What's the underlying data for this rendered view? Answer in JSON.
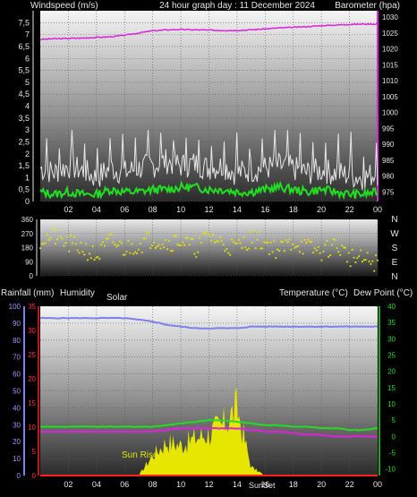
{
  "header": {
    "windspeed_label": "Windspeed (m/s)",
    "title": "24 hour graph day : 11 December 2024",
    "barometer_label": "Barometer (hpa)"
  },
  "direction_labels": [
    "N",
    "W",
    "S",
    "E",
    "N"
  ],
  "bottom_labels": {
    "rainfall": "Rainfall (mm)",
    "humidity": "Humidity",
    "solar": "Solar",
    "temperature": "Temperature (°C)",
    "dewpoint": "Dew Point (°C)"
  },
  "annotations": {
    "sunrise": "Sun Rise",
    "sunset": "SunSet"
  },
  "colors": {
    "background": "#000000",
    "wind_speed": "#e8e8e8",
    "wind_gust": "#22dd22",
    "barometer": "#dd22dd",
    "wind_direction": "#e6e600",
    "humidity": "#7f7ff0",
    "temperature": "#22dd22",
    "dew_point": "#dd22dd",
    "solar": "#e6e600",
    "rain": "#ff2020"
  },
  "chart_data": [
    {
      "type": "line",
      "name": "wind-barometer",
      "x_ticks": [
        "02",
        "04",
        "06",
        "08",
        "10",
        "12",
        "14",
        "16",
        "18",
        "20",
        "22",
        "00"
      ],
      "ylim_left": [
        0,
        8
      ],
      "yticks_left": [
        "0",
        "0,5",
        "1",
        "1,5",
        "2",
        "2,5",
        "3",
        "3,5",
        "4",
        "4,5",
        "5",
        "5,5",
        "6",
        "6,5",
        "7",
        "7,5"
      ],
      "ylim_right": [
        972,
        1032
      ],
      "yticks_right": [
        "975",
        "980",
        "985",
        "990",
        "995",
        "1000",
        "1005",
        "1010",
        "1015",
        "1020",
        "1025",
        "1030"
      ],
      "series": [
        {
          "values_hourly": [
            1.4,
            1.2,
            1.5,
            1.3,
            1.0,
            1.4,
            1.2,
            1.4,
            1.5,
            1.7,
            1.5,
            1.6,
            1.4,
            1.5,
            1.2,
            1.3,
            1.4,
            1.5,
            1.4,
            1.2,
            1.3,
            1.2,
            1.1,
            1.0,
            1.2
          ]
        },
        {
          "values_hourly": [
            0.4,
            0.3,
            0.4,
            0.3,
            0.3,
            0.5,
            0.4,
            0.4,
            0.5,
            0.5,
            0.6,
            0.6,
            0.5,
            0.5,
            0.4,
            0.4,
            0.5,
            0.6,
            0.5,
            0.4,
            0.5,
            0.4,
            0.3,
            0.3,
            0.4
          ]
        },
        {
          "values_hourly": [
            1023.0,
            1023.2,
            1023.3,
            1023.4,
            1023.6,
            1023.8,
            1024.3,
            1025.0,
            1025.7,
            1026.0,
            1026.1,
            1026.0,
            1025.9,
            1025.8,
            1025.8,
            1026.0,
            1026.3,
            1026.6,
            1026.8,
            1027.0,
            1027.3,
            1027.5,
            1027.7,
            1027.8,
            1027.8
          ]
        }
      ]
    },
    {
      "type": "scatter",
      "name": "wind-direction",
      "x_ticks": [
        "02",
        "04",
        "06",
        "08",
        "10",
        "12",
        "14",
        "16",
        "18",
        "20",
        "22",
        "00"
      ],
      "ylim": [
        0,
        360
      ],
      "yticks": [
        "0",
        "90",
        "180",
        "270",
        "360"
      ],
      "values_hourly": [
        230,
        250,
        200,
        180,
        120,
        220,
        170,
        200,
        240,
        210,
        230,
        170,
        260,
        200,
        180,
        240,
        210,
        160,
        220,
        180,
        150,
        200,
        120,
        100,
        80
      ]
    },
    {
      "type": "line",
      "name": "temperature-humidity-solar",
      "x_ticks": [
        "02",
        "04",
        "06",
        "08",
        "10",
        "12",
        "14",
        "16",
        "18",
        "20",
        "22",
        "00"
      ],
      "ylim_humidity": [
        0,
        100
      ],
      "yticks_humidity": [
        "0",
        "10",
        "20",
        "30",
        "40",
        "50",
        "60",
        "70",
        "80",
        "90",
        "100"
      ],
      "ylim_rain": [
        0,
        35
      ],
      "yticks_rain": [
        "0",
        "5",
        "10",
        "15",
        "20",
        "25",
        "30",
        "35"
      ],
      "ylim_temp": [
        -12,
        40
      ],
      "yticks_temp": [
        "-10",
        "-5",
        "0",
        "5",
        "10",
        "15",
        "20",
        "25",
        "30",
        "35",
        "40"
      ],
      "series": [
        {
          "values_hourly": [
            93,
            93,
            93,
            93,
            93,
            93,
            93,
            92,
            91,
            89,
            88,
            87,
            87,
            87,
            87,
            88,
            88,
            88,
            88,
            88,
            88,
            88,
            88,
            88,
            88
          ]
        },
        {
          "values_hourly": [
            3,
            3,
            3,
            3,
            3,
            3,
            3,
            3,
            3,
            3.5,
            4,
            4.5,
            5,
            5,
            4.5,
            4,
            3.5,
            3.5,
            3,
            3,
            2.5,
            2.5,
            2,
            2,
            2.5
          ]
        },
        {
          "values_hourly": [
            1.5,
            1.5,
            1.5,
            1.5,
            1.5,
            1.5,
            1.5,
            1.5,
            1.5,
            2,
            2.5,
            2.5,
            2.5,
            2.5,
            2.5,
            2,
            1.5,
            1.5,
            1,
            0.5,
            0.5,
            0,
            0,
            0,
            0
          ]
        },
        {
          "values_hourly": [
            0,
            0,
            0,
            0,
            0,
            0,
            0,
            0,
            12,
            20,
            18,
            22,
            25,
            30,
            40,
            5,
            0,
            0,
            0,
            0,
            0,
            0,
            0,
            0,
            0
          ]
        },
        {
          "values_hourly": [
            0,
            0,
            0,
            0,
            0,
            0,
            0,
            0,
            0,
            0,
            0,
            0,
            0,
            0,
            0,
            0,
            0,
            0,
            0,
            0,
            0,
            0,
            0,
            0,
            0
          ]
        }
      ]
    }
  ]
}
